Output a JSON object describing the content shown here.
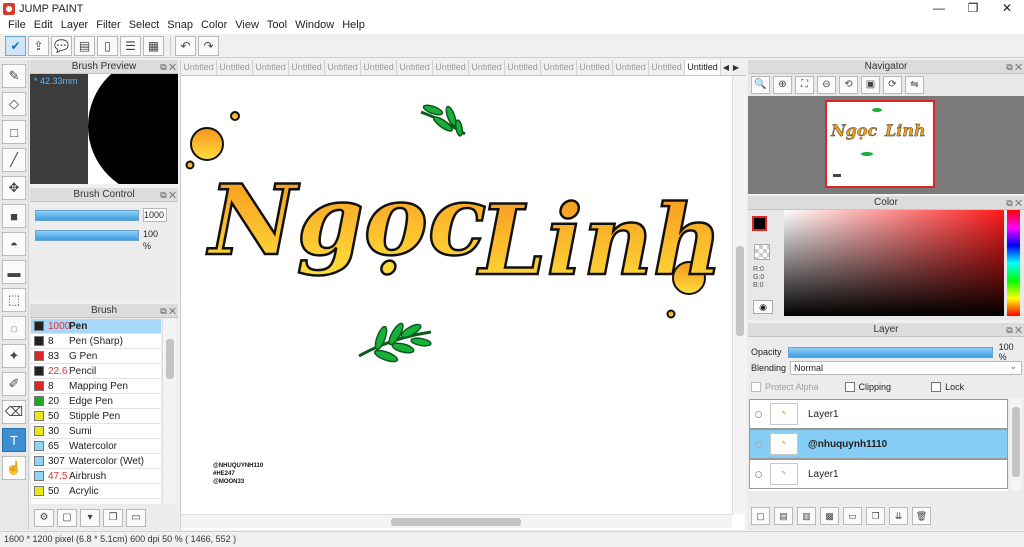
{
  "window": {
    "title": "JUMP PAINT",
    "controls": [
      "—",
      "❐",
      "✕"
    ]
  },
  "menu": [
    "File",
    "Edit",
    "Layer",
    "Filter",
    "Select",
    "Snap",
    "Color",
    "View",
    "Tool",
    "Window",
    "Help"
  ],
  "toolbar": {
    "undo_icon": "↶",
    "redo_icon": "↷"
  },
  "panels": {
    "brush_preview": "Brush Preview",
    "brush_control": "Brush Control",
    "brush": "Brush",
    "navigator": "Navigator",
    "color": "Color",
    "layer": "Layer"
  },
  "brush_preview": {
    "size": "* 42.33mm"
  },
  "brush_control": {
    "size_value": "1000",
    "opacity_value": "100 %"
  },
  "brushes": [
    {
      "size": "1000",
      "name": "Pen",
      "color": "#222222",
      "size_red": true,
      "selected": true
    },
    {
      "size": "8",
      "name": "Pen (Sharp)",
      "color": "#222222",
      "size_red": false
    },
    {
      "size": "83",
      "name": "G Pen",
      "color": "#e02424",
      "size_red": false
    },
    {
      "size": "22.6",
      "name": "Pencil",
      "color": "#222222",
      "size_red": true
    },
    {
      "size": "8",
      "name": "Mapping Pen",
      "color": "#e02424",
      "size_red": false
    },
    {
      "size": "20",
      "name": "Edge Pen",
      "color": "#1fa81f",
      "size_red": false
    },
    {
      "size": "50",
      "name": "Stipple Pen",
      "color": "#e8e818",
      "size_red": false
    },
    {
      "size": "30",
      "name": "Sumi",
      "color": "#e8e818",
      "size_red": false
    },
    {
      "size": "65",
      "name": "Watercolor",
      "color": "#8fd6f5",
      "size_red": false
    },
    {
      "size": "307",
      "name": "Watercolor (Wet)",
      "color": "#8fd6f5",
      "size_red": false
    },
    {
      "size": "47.5",
      "name": "Airbrush",
      "color": "#8fd6f5",
      "size_red": true
    },
    {
      "size": "50",
      "name": "Acrylic",
      "color": "#e8e818",
      "size_red": false
    }
  ],
  "tabs": [
    "Untitled",
    "Untitled",
    "Untitled",
    "Untitled",
    "Untitled",
    "Untitled",
    "Untitled",
    "Untitled",
    "Untitled",
    "Untitled",
    "Untitled",
    "Untitled",
    "Untitled",
    "Untitled",
    "Untitled"
  ],
  "canvas": {
    "word1": "Ngọc",
    "word2": "Linh",
    "handles": [
      "@NHUQUYNH110",
      "#HE247",
      "@MOON33"
    ]
  },
  "navigator_thumb": {
    "word1": "Ngọc",
    "word2": "Linh"
  },
  "color": {
    "r": "R:0",
    "g": "G:0",
    "b": "B:0",
    "foreground": "#000000",
    "background": "#ffffff"
  },
  "layer": {
    "opacity_label": "Opacity",
    "opacity_value": "100 %",
    "blending_label": "Blending",
    "blending_value": "Normal",
    "protect_alpha": "Protect Alpha",
    "clipping": "Clipping",
    "lock": "Lock",
    "layers": [
      {
        "name": "Layer1",
        "selected": false
      },
      {
        "name": "@nhuquynh1110",
        "selected": true
      },
      {
        "name": "Layer1",
        "selected": false
      }
    ]
  },
  "status": "1600 * 1200 pixel   (6.8 * 5.1cm)   600 dpi   50 %   ( 1466, 552 )",
  "accent_colors": {
    "selection": "#86cdf5",
    "slider": "#3d9ee0",
    "nav_frame": "#e02424"
  }
}
